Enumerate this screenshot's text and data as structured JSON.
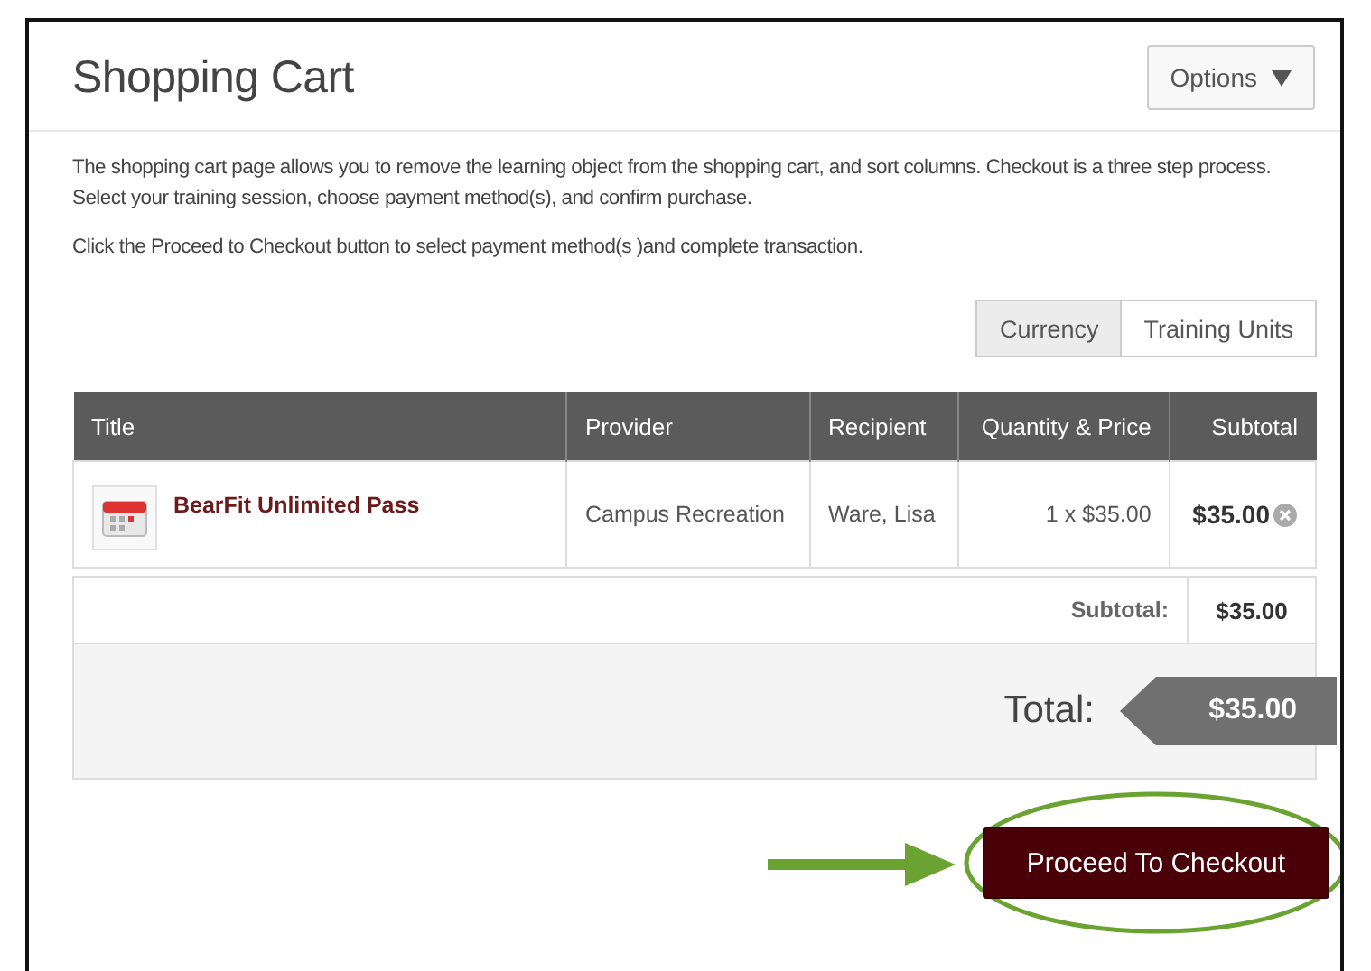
{
  "header": {
    "title": "Shopping Cart",
    "options_button": "Options"
  },
  "intro": [
    "The shopping cart page allows you to remove the learning object from the shopping cart, and sort columns. Checkout is a three step process. Select your training session, choose payment method(s), and confirm purchase.",
    "Click the Proceed to Checkout button to select payment method(s )and  complete transaction."
  ],
  "view_toggle": [
    {
      "label": "Currency",
      "selected": true
    },
    {
      "label": "Training Units",
      "selected": false
    }
  ],
  "table": {
    "columns": [
      "Title",
      "Provider",
      "Recipient",
      "Quantity & Price",
      "Subtotal"
    ],
    "rows": [
      {
        "title": "BearFit Unlimited Pass",
        "provider": "Campus Recreation",
        "recipient": "Ware, Lisa",
        "quantity_price": "1 x $35.00",
        "subtotal": "$35.00"
      }
    ]
  },
  "subtotal": {
    "label": "Subtotal:",
    "value": "$35.00"
  },
  "total": {
    "label": "Total:",
    "value": "$35.00"
  },
  "checkout_button": "Proceed To Checkout"
}
